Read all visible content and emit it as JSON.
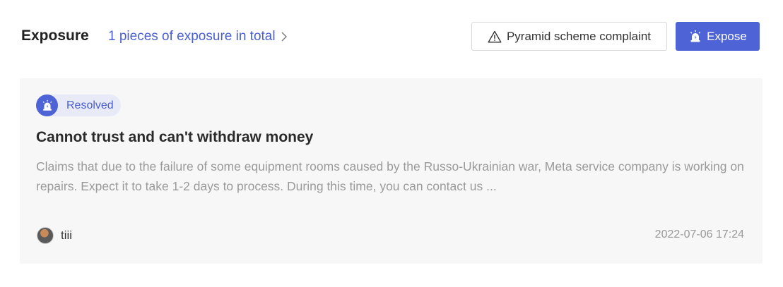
{
  "header": {
    "title": "Exposure",
    "total_link": "1 pieces of exposure in total",
    "complaint_button": "Pyramid scheme complaint",
    "expose_button": "Expose"
  },
  "card": {
    "status": "Resolved",
    "title": "Cannot trust and can't withdraw money",
    "description": "Claims that due to the failure of some equipment rooms caused by the Russo-Ukrainian war, Meta service company is working on repairs. Expect it to take 1-2 days to process. During this time, you can contact us ...",
    "username": "tiii",
    "timestamp": "2022-07-06 17:24"
  },
  "icons": {
    "total_chevron": "chevron-right-icon",
    "complaint": "warning-triangle-icon",
    "expose": "alarm-siren-icon",
    "status": "alarm-siren-icon"
  },
  "colors": {
    "accent": "#4d63d6",
    "link": "#4a5fd0",
    "card_bg": "#f7f7f8",
    "badge_bg": "#e8ebf7"
  }
}
